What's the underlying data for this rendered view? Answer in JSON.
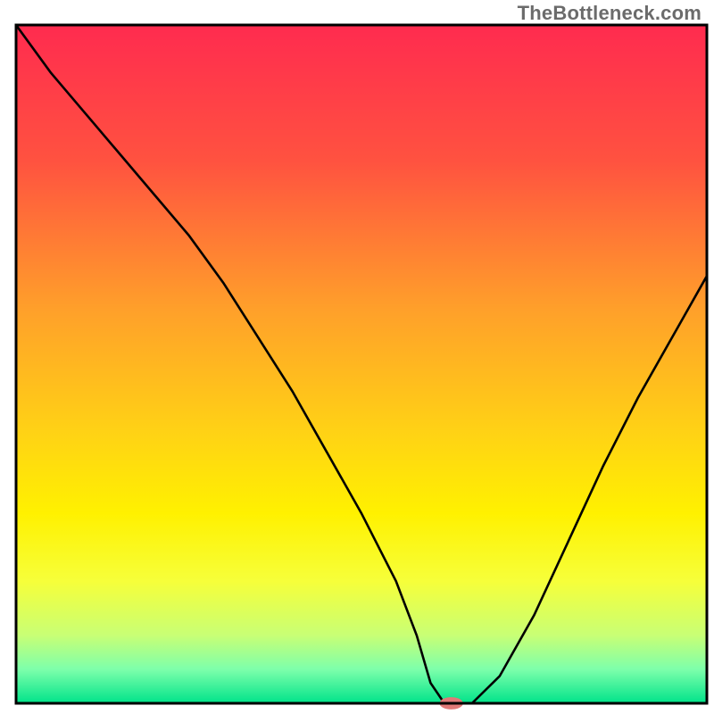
{
  "attribution": "TheBottleneck.com",
  "chart_data": {
    "type": "line",
    "title": "",
    "xlabel": "",
    "ylabel": "",
    "xlim": [
      0,
      100
    ],
    "ylim": [
      0,
      100
    ],
    "gradient_stops": [
      {
        "offset": 0.0,
        "color": "#ff2b4f"
      },
      {
        "offset": 0.2,
        "color": "#ff5240"
      },
      {
        "offset": 0.42,
        "color": "#ffa02a"
      },
      {
        "offset": 0.6,
        "color": "#ffd215"
      },
      {
        "offset": 0.72,
        "color": "#fff100"
      },
      {
        "offset": 0.82,
        "color": "#f6ff3a"
      },
      {
        "offset": 0.9,
        "color": "#c8ff75"
      },
      {
        "offset": 0.95,
        "color": "#7dffab"
      },
      {
        "offset": 1.0,
        "color": "#00e38a"
      }
    ],
    "series": [
      {
        "name": "curve",
        "x": [
          0,
          5,
          10,
          15,
          20,
          25,
          30,
          35,
          40,
          45,
          50,
          55,
          58,
          60,
          62,
          64,
          66,
          70,
          75,
          80,
          85,
          90,
          95,
          100
        ],
        "y": [
          100,
          93,
          87,
          81,
          75,
          69,
          62,
          54,
          46,
          37,
          28,
          18,
          10,
          3,
          0,
          0,
          0,
          4,
          13,
          24,
          35,
          45,
          54,
          63
        ]
      }
    ],
    "marker": {
      "x": 63,
      "y": 0,
      "rx_pct": 1.7,
      "ry_pct": 0.9,
      "color": "#e07a78"
    }
  }
}
